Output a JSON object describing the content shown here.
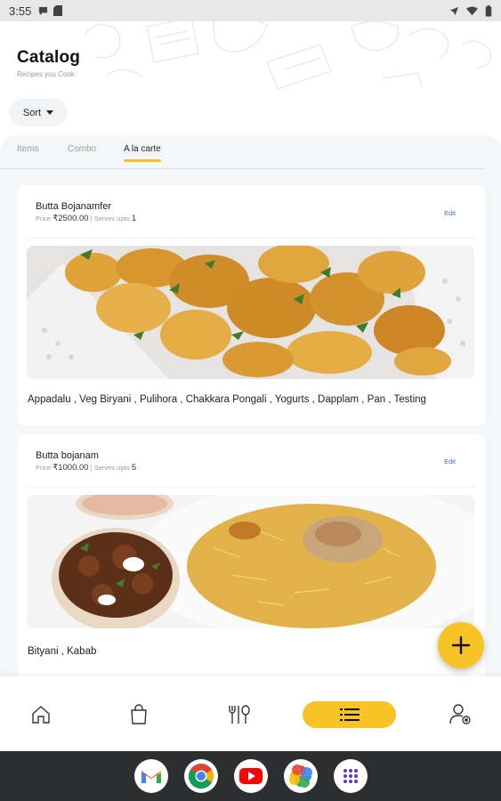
{
  "status_bar": {
    "time": "3:55",
    "left_icons": [
      "message-icon",
      "sd-card-icon"
    ],
    "right_icons": [
      "location-icon",
      "wifi-icon",
      "battery-icon"
    ]
  },
  "header": {
    "title": "Catalog",
    "subtitle": "Recipes you Cook"
  },
  "sort": {
    "label": "Sort"
  },
  "tabs": [
    {
      "label": "Items",
      "active": false
    },
    {
      "label": "Combo",
      "active": false
    },
    {
      "label": "A la carte",
      "active": true
    }
  ],
  "cards": [
    {
      "title": "Butta Bojanamfer",
      "price_label": "Price",
      "price": "₹2500.00",
      "serves_label": "Serves upto",
      "serves": "1",
      "edit_label": "Edit",
      "image": "cauliflower-potato-curry",
      "items": "Appadalu ,  Veg Biryani ,  Pulihora ,  Chakkara Pongali ,  Yogurts ,  Dapplam ,  Pan ,  Testing"
    },
    {
      "title": "Butta bojanam",
      "price_label": "Price",
      "price": "₹1000.00",
      "serves_label": "Serves upto",
      "serves": "5",
      "edit_label": "Edit",
      "image": "biryani-with-curry",
      "items": "Bityani ,  Kabab"
    }
  ],
  "fab": {
    "icon": "plus-icon"
  },
  "bottom_nav": [
    {
      "name": "home",
      "icon": "home-icon",
      "active": false
    },
    {
      "name": "orders",
      "icon": "shopping-bag-icon",
      "active": false
    },
    {
      "name": "kitchen",
      "icon": "fork-spoon-icon",
      "active": false
    },
    {
      "name": "catalog",
      "icon": "list-icon",
      "active": true
    },
    {
      "name": "profile",
      "icon": "user-settings-icon",
      "active": false
    }
  ],
  "dock": [
    "gmail-icon",
    "chrome-icon",
    "youtube-icon",
    "photos-icon",
    "app-drawer-icon"
  ],
  "colors": {
    "accent": "#f7c325",
    "link": "#3b6fd6",
    "panel_bg": "#f5f6f7",
    "dock_bg": "#2d2e30"
  }
}
